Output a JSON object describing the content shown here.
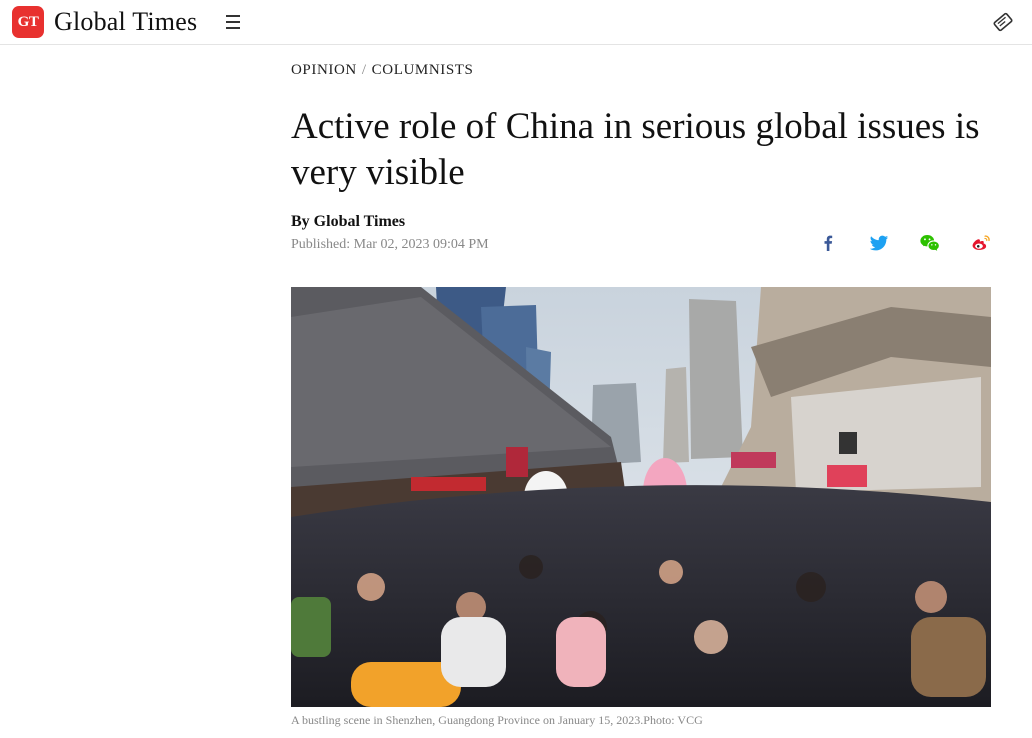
{
  "header": {
    "logo_badge": "GT",
    "logo_text": "Global Times",
    "menu_icon": "hamburger-menu-icon",
    "right_icon": "newspaper-icon"
  },
  "breadcrumb": {
    "section": "OPINION",
    "separator": "/",
    "subsection": "COLUMNISTS"
  },
  "article": {
    "title": "Active role of China in serious global issues is very visible",
    "byline": "By Global Times",
    "published": "Published: Mar 02, 2023 09:04 PM",
    "caption": "A bustling scene in Shenzhen, Guangdong Province on January 15, 2023.Photo: VCG"
  },
  "share": [
    {
      "name": "facebook",
      "icon": "facebook-icon",
      "color": "#3b5998"
    },
    {
      "name": "twitter",
      "icon": "twitter-icon",
      "color": "#1da1f2"
    },
    {
      "name": "wechat",
      "icon": "wechat-icon",
      "color": "#2dc100"
    },
    {
      "name": "weibo",
      "icon": "weibo-icon",
      "color": "#e6162d"
    }
  ],
  "colors": {
    "brand": "#e8312f",
    "text": "#111111",
    "muted": "#888888"
  }
}
